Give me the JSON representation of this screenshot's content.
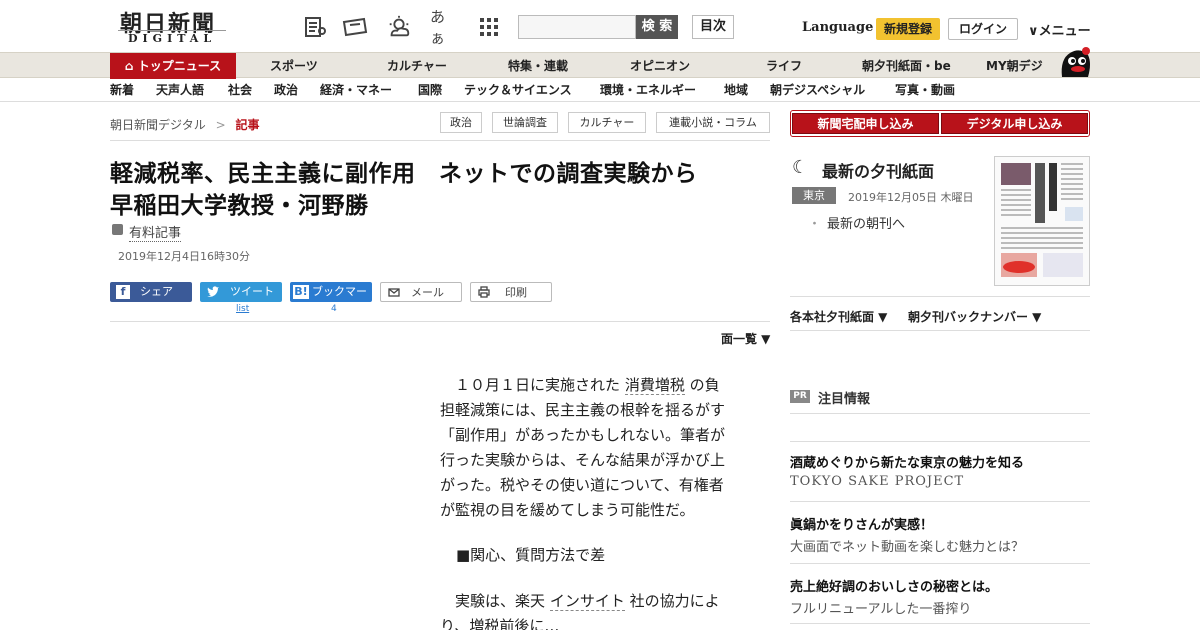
{
  "header": {
    "logo": "朝日新聞",
    "logo_sub": "DIGITAL",
    "search_button": "検 索",
    "toc_button": "目次",
    "language": "Language",
    "register": "新規登録",
    "login": "ログイン",
    "menu": "メニュー",
    "kana_icon_text": "あぁ"
  },
  "nav_primary": [
    "トップニュース",
    "スポーツ",
    "カルチャー",
    "特集・連載",
    "オピニオン",
    "ライフ",
    "朝夕刊紙面・be",
    "MY朝デジ"
  ],
  "nav_secondary": [
    "新着",
    "天声人語",
    "社会",
    "政治",
    "経済・マネー",
    "国際",
    "テック＆サイエンス",
    "環境・エネルギー",
    "地域",
    "朝デジスペシャル",
    "写真・動画"
  ],
  "breadcrumb": {
    "home": "朝日新聞デジタル",
    "separator": ">",
    "current": "記事"
  },
  "tags": [
    "政治",
    "世論調査",
    "カルチャー",
    "連載小説・コラム"
  ],
  "article": {
    "title_line1": "軽減税率、民主主義に副作用　ネットでの調査実験から",
    "title_line2": "早稲田大学教授・河野勝",
    "paid_label": "有料記事",
    "date": "2019年12月4日16時30分",
    "share": {
      "facebook": "シェア",
      "twitter": "ツイート",
      "hatena": "ブックマーク",
      "hatena_badge": "B!",
      "mail": "メール",
      "print": "印刷",
      "twitter_count": "list",
      "hatena_count": "4"
    },
    "page_list": "面一覧 ▼",
    "p1_a": "１０月１日に実施された",
    "p1_link": "消費増税",
    "p1_b": "の負",
    "p1_lines": [
      "担軽減策には、民主主義の根幹を揺るがす",
      "「副作用」があったかもしれない。筆者が",
      "行った実験からは、そんな結果が浮かび上",
      "がった。税やその使い道について、有権者",
      "が監視の目を緩めてしまう可能性だ。"
    ],
    "subhead": "■関心、質問方法で差",
    "p2_a": "実験は、楽天",
    "p2_link": "インサイト",
    "p2_b": "社の協力によ",
    "p2_line2": "り、増税前後に…"
  },
  "sidebar": {
    "apply_paper": "新聞宅配申し込み",
    "apply_digital": "デジタル申し込み",
    "evening_title": "最新の夕刊紙面",
    "region": "東京",
    "evening_date": "2019年12月05日 木曜日",
    "morning_link": "最新の朝刊へ",
    "dropdown1": "各本社夕刊紙面 ▼",
    "dropdown2": "朝夕刊バックナンバー ▼",
    "pr_badge": "PR",
    "pr_title": "注目情報",
    "ads": [
      {
        "head": "酒蔵めぐりから新たな東京の魅力を知る",
        "sub": "TOKYO SAKE PROJECT"
      },
      {
        "head": "眞鍋かをりさんが実感！",
        "sub": "大画面でネット動画を楽しむ魅力とは？"
      },
      {
        "head": "売上絶好調のおいしさの秘密とは。",
        "sub": "フルリニューアルした一番搾り"
      }
    ]
  },
  "colors": {
    "brand_red": "#b8121a",
    "register_yellow": "#f2c230",
    "facebook": "#3b5a98",
    "twitter": "#3399d8",
    "hatena": "#2a7bd1"
  }
}
